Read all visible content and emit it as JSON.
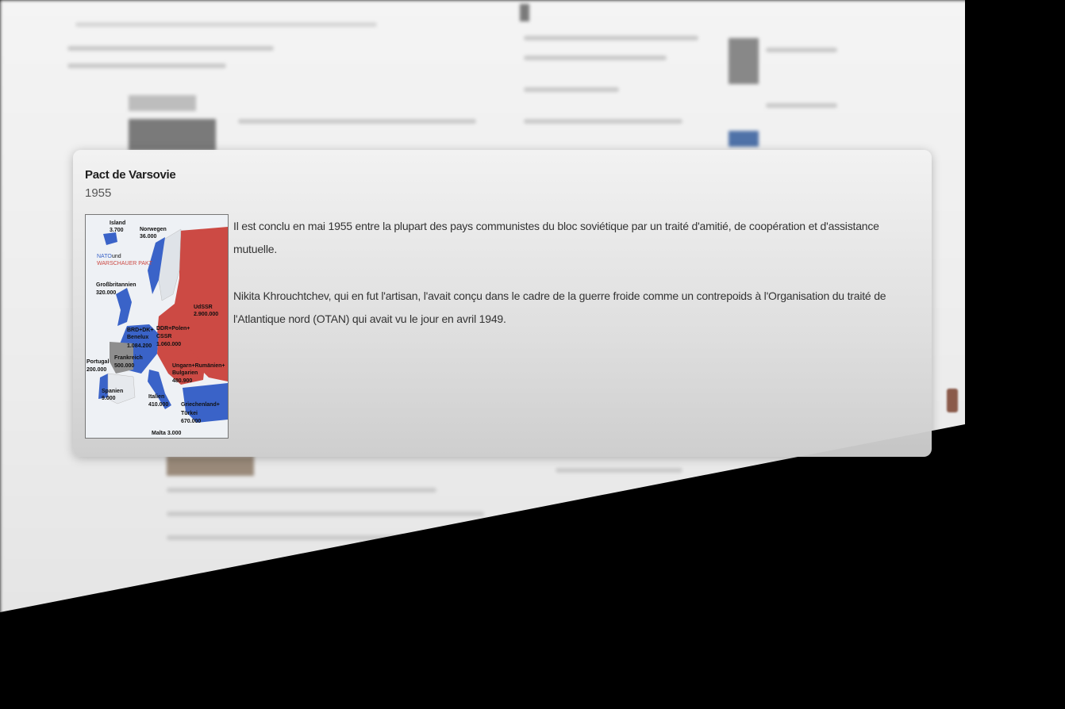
{
  "card": {
    "title": "Pact de Varsovie",
    "year": "1955",
    "paragraphs": [
      "Il est conclu en mai 1955 entre la plupart des pays communistes du bloc soviétique par un traité d'amitié, de coopération et d'assistance mutuelle.",
      "Nikita Khrouchtchev, qui en fut l'artisan, l'avait conçu dans le cadre de la guerre froide comme un contrepoids à l'Organisation du traité de l'Atlantique nord (OTAN) qui avait vu le jour en avril 1949."
    ]
  },
  "map": {
    "legend_nato": "NATO",
    "legend_und": "und",
    "legend_warsaw": "WARSCHAUER PAKT",
    "nato_color": "#3a63c8",
    "warsaw_color": "#cc4a44",
    "labels": {
      "island": "Island",
      "island_val": "3.700",
      "norwegen": "Norwegen",
      "norwegen_val": "36.000",
      "gb": "Großbritannien",
      "gb_val": "320.000",
      "udssr": "UdSSR",
      "udssr_val": "2.900.000",
      "brd": "BRD+DK+",
      "benelux": "Benelux",
      "brd_val": "1.084.200",
      "ddr": "DDR+Polen+",
      "cssr": "CSSR",
      "ddr_val": "1.060.000",
      "portugal": "Portugal",
      "portugal_val": "200.000",
      "frankreich": "Frankreich",
      "frankreich_val": "500.000",
      "ungarn": "Ungarn+Rumänien+",
      "bulgarien": "Bulgarien",
      "ungarn_val": "480.900",
      "spanien": "Spanien",
      "spanien_val": "9.000",
      "italien": "Italien",
      "italien_val": "410.000",
      "griechenland": "Griechenland+",
      "tuerkei": "Türkei",
      "griechenland_val": "670.000",
      "malta": "Malta 3.000"
    }
  }
}
